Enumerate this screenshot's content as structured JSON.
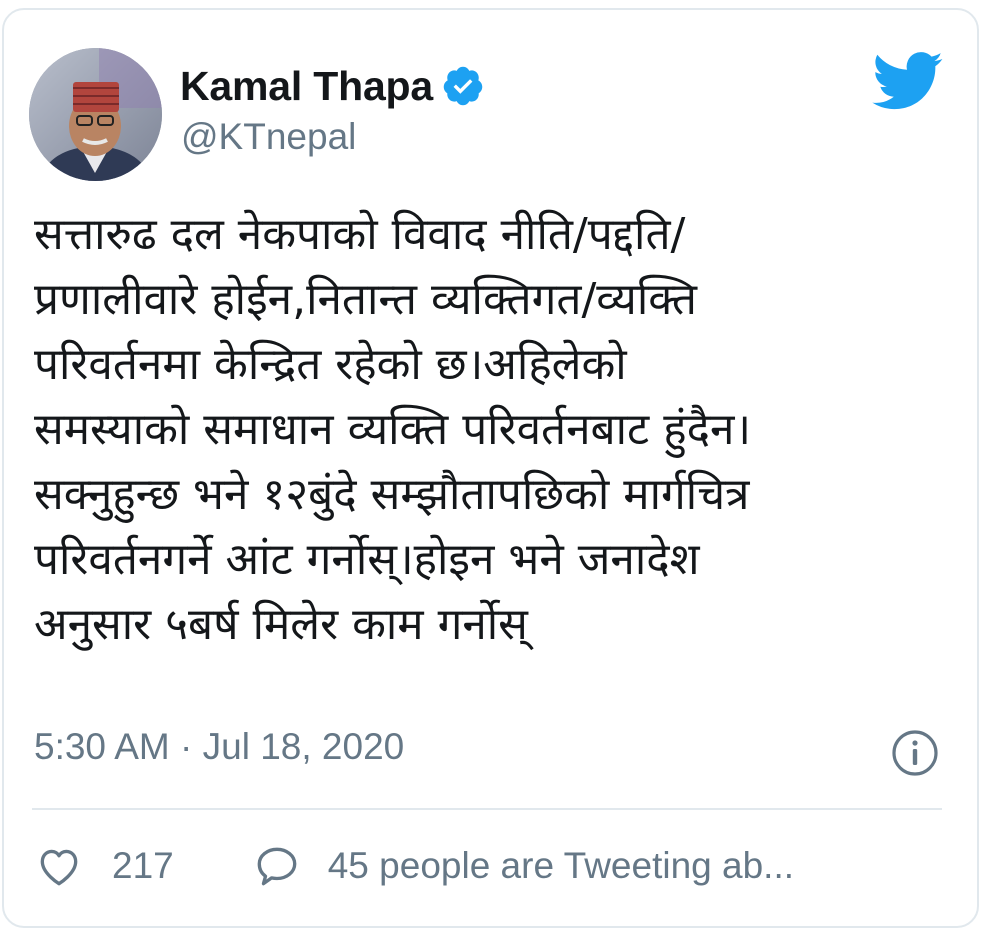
{
  "tweet": {
    "author": {
      "display_name": "Kamal Thapa",
      "handle": "@KTnepal",
      "verified": true
    },
    "text_lines": [
      "सत्तारुढ दल नेकपाको विवाद नीति/पद्दति/",
      "प्रणालीवारे होईन,नितान्त व्यक्तिगत/व्यक्ति",
      "परिवर्तनमा केन्द्रित रहेको छ।अहिलेको",
      "समस्याको समाधान व्यक्ति परिवर्तनबाट हुंदैन।",
      "सक्नुहुन्छ भने १२बुंदे सम्झौतापछिको मार्गचित्र",
      "परिवर्तनगर्ने आंट गर्नोस्।होइन भने जनादेश",
      "अनुसार ५बर्ष मिलेर काम गर्नोस्"
    ],
    "timestamp": "5:30 AM · Jul 18, 2020",
    "like_count": "217",
    "conversation_label": "45 people are Tweeting ab..."
  },
  "colors": {
    "twitter_blue": "#1da1f2",
    "text_primary": "#14171a",
    "text_secondary": "#657786",
    "border": "#e1e8ed"
  },
  "icons": {
    "brand": "twitter-bird-icon",
    "verified": "verified-badge-icon",
    "info": "info-icon",
    "like": "heart-icon",
    "reply": "speech-bubble-icon"
  }
}
